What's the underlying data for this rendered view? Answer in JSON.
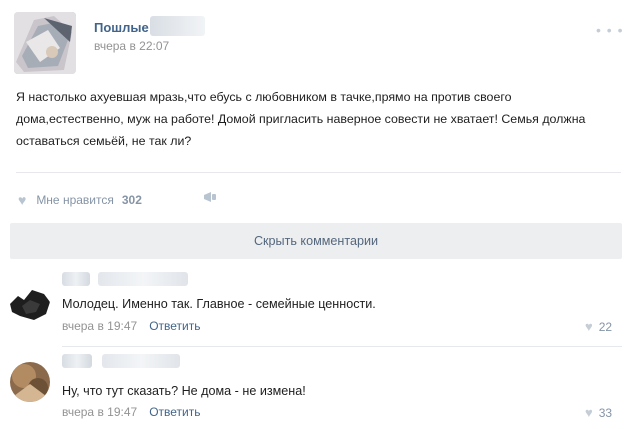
{
  "post": {
    "group_name": "Пошлые",
    "time": "вчера в 22:07",
    "more_icon": "more-horizontal-icon",
    "text": "Я настолько ахуевшая мразь,что ебусь с любовником в тачке,прямо на против своего дома,естественно, муж на работе! Домой пригласить наверное совести не хватает! Семья должна оставаться семьёй, не так ли?",
    "like_label": "Мне нравится",
    "like_count": "302",
    "hide_comments_label": "Скрыть комментарии"
  },
  "comments": [
    {
      "text": "Молодец. Именно так. Главное - семейные ценности.",
      "time": "вчера в 19:47",
      "reply_label": "Ответить",
      "likes": "22"
    },
    {
      "text": "Ну, что тут сказать? Не дома - не измена!",
      "time": "вчера в 19:47",
      "reply_label": "Ответить",
      "likes": "33"
    }
  ],
  "colors": {
    "link": "#42648b",
    "meta": "#939393",
    "button_bg": "#edeef0"
  }
}
